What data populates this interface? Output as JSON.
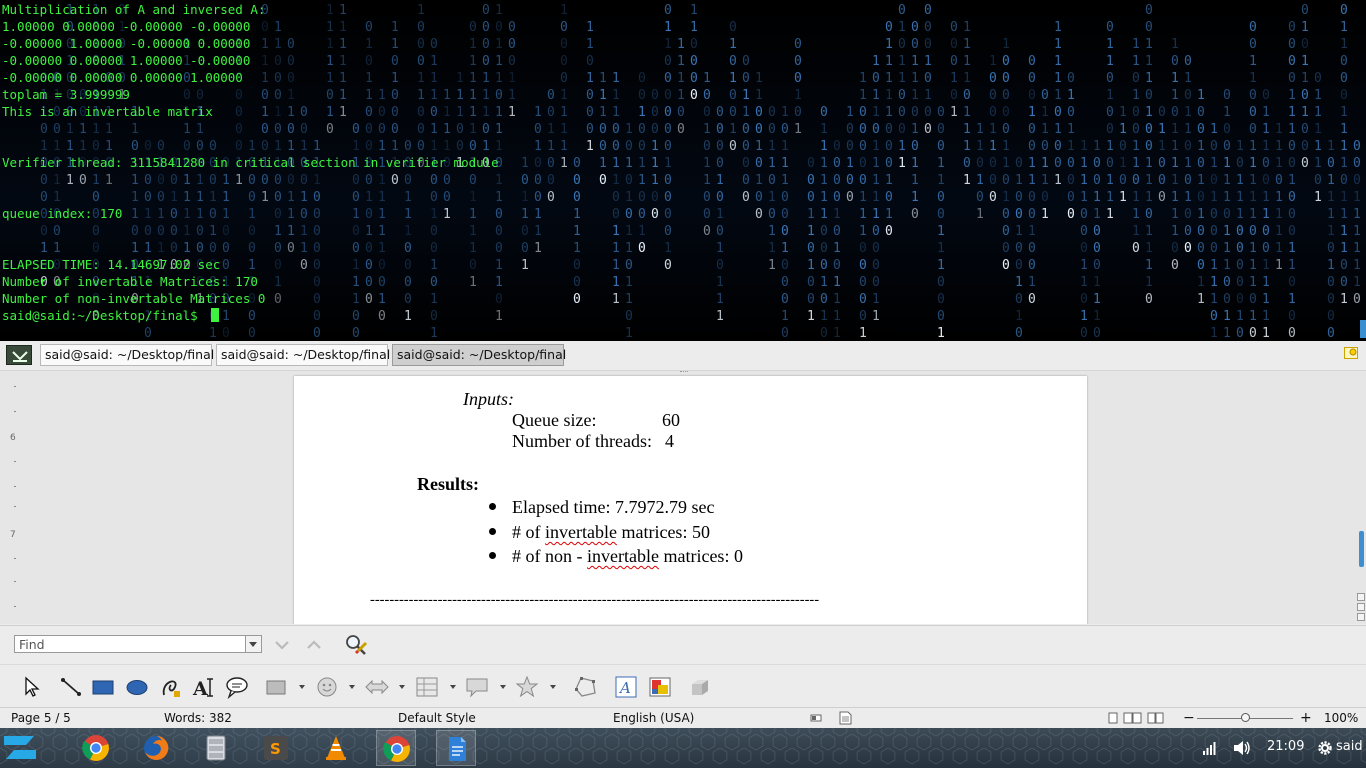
{
  "terminal": {
    "lines": [
      "Multiplication of A and inversed A:",
      "1.00000 0.00000 -0.00000 -0.00000",
      "-0.00000 1.00000 -0.00000 0.00000",
      "-0.00000 0.00000 1.00000 -0.00000",
      "-0.00000 0.00000 0.00000 1.00000",
      "toplam = 3.999999",
      "This is an invertable matrix",
      "",
      "",
      "Verifier thread: 3115841280 in critical section in verifier module",
      "",
      "",
      "queue index: 170",
      "",
      "",
      "ELAPSED TIME: 14.14697.02 sec",
      "Number of invertable Matrices: 170",
      "Number of non-invertable Matrices 0",
      "said@said:~/Desktop/final$ "
    ],
    "text_color": "#3ff23f"
  },
  "tabs": [
    {
      "label": "said@said: ~/Desktop/final"
    },
    {
      "label": "said@said: ~/Desktop/final"
    },
    {
      "label": "said@said: ~/Desktop/final"
    }
  ],
  "ruler": {
    "marks": [
      "6",
      "7"
    ]
  },
  "document": {
    "inputs_heading": "Inputs:",
    "queue_size_label": "Queue size:",
    "queue_size_value": "60",
    "threads_label": "Number of threads:",
    "threads_value": "4",
    "results_heading": "Results:",
    "bullet1": "Elapsed time: 7.7972.79 sec",
    "bullet2_pre": "# of ",
    "bullet2_word": "invertable",
    "bullet2_post": " matrices: 50",
    "bullet3_pre": "# of non - ",
    "bullet3_word": "invertable",
    "bullet3_post": " matrices: 0",
    "separator": "---------------------------------------------------------------------------------------------"
  },
  "findbar": {
    "placeholder": "Find"
  },
  "drawing_toolbar": {
    "icons": [
      "select-icon",
      "line-icon",
      "rectangle-icon",
      "ellipse-icon",
      "curve-icon",
      "text-icon",
      "callout-icon",
      "basic-shapes-icon",
      "symbol-shapes-icon",
      "block-arrows-icon",
      "flowchart-icon",
      "callouts-icon",
      "stars-icon",
      "points-icon",
      "fontwork-icon",
      "from-file-icon",
      "extrusion-icon"
    ]
  },
  "statusbar": {
    "page": "Page 5 / 5",
    "words": "Words: 382",
    "style": "Default Style",
    "language": "English (USA)",
    "zoom_minus": "−",
    "zoom_plus": "+",
    "zoom": "100%"
  },
  "taskbar": {
    "apps": [
      "chrome-icon",
      "firefox-icon",
      "file-manager-icon",
      "sublime-text-icon",
      "vlc-icon",
      "chrome-icon",
      "writer-icon"
    ],
    "time": "21:09",
    "user": "said"
  },
  "colors": {
    "accent": "#3e8ed0",
    "taskbar": "#2e3a44"
  }
}
